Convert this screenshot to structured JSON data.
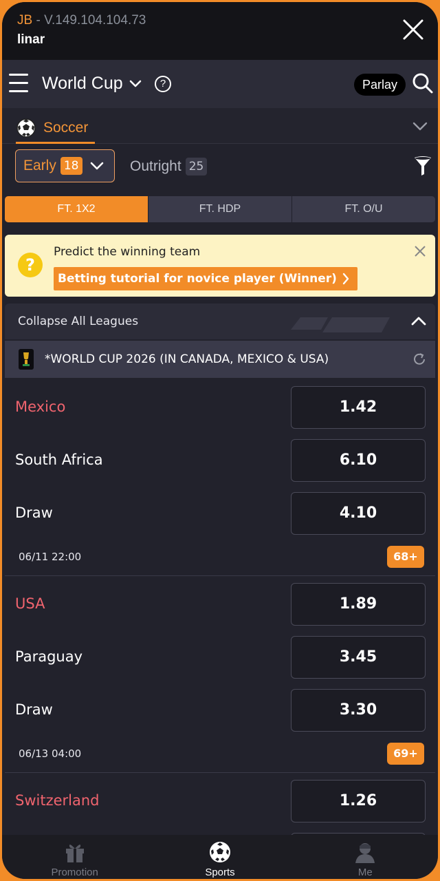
{
  "header": {
    "brand": "JB",
    "separator": " - ",
    "version": "V.149.104.104.73",
    "username": "linar"
  },
  "nav": {
    "title": "World Cup",
    "parlay_label": "Parlay"
  },
  "sport": {
    "label": "Soccer"
  },
  "filters": {
    "early_label": "Early",
    "early_count": "18",
    "outright_label": "Outright",
    "outright_count": "25"
  },
  "market_tabs": [
    "FT. 1X2",
    "FT. HDP",
    "FT. O/U"
  ],
  "banner": {
    "title": "Predict the winning team",
    "link": "Betting tutorial for novice player (Winner)"
  },
  "collapse_label": "Collapse All Leagues",
  "league": {
    "name": "*WORLD CUP 2026 (IN CANADA, MEXICO & USA)"
  },
  "matches": [
    {
      "home": "Mexico",
      "home_odd": "1.42",
      "away": "South Africa",
      "away_odd": "6.10",
      "draw": "Draw",
      "draw_odd": "4.10",
      "time": "06/11 22:00",
      "more": "68+"
    },
    {
      "home": "USA",
      "home_odd": "1.89",
      "away": "Paraguay",
      "away_odd": "3.45",
      "draw": "Draw",
      "draw_odd": "3.30",
      "time": "06/13 04:00",
      "more": "69+"
    },
    {
      "home": "Switzerland",
      "home_odd": "1.26"
    }
  ],
  "bottom_nav": {
    "promotion": "Promotion",
    "sports": "Sports",
    "me": "Me"
  },
  "colors": {
    "accent": "#f28c28",
    "home_team": "#f0646e",
    "background": "#22222c"
  },
  "icons": [
    "close-icon",
    "menu-icon",
    "chevron-down-icon",
    "help-icon",
    "search-icon",
    "soccer-ball-icon",
    "filter-icon",
    "question-icon",
    "chevron-up-icon",
    "refresh-icon",
    "trophy-icon",
    "gift-icon",
    "user-icon"
  ]
}
